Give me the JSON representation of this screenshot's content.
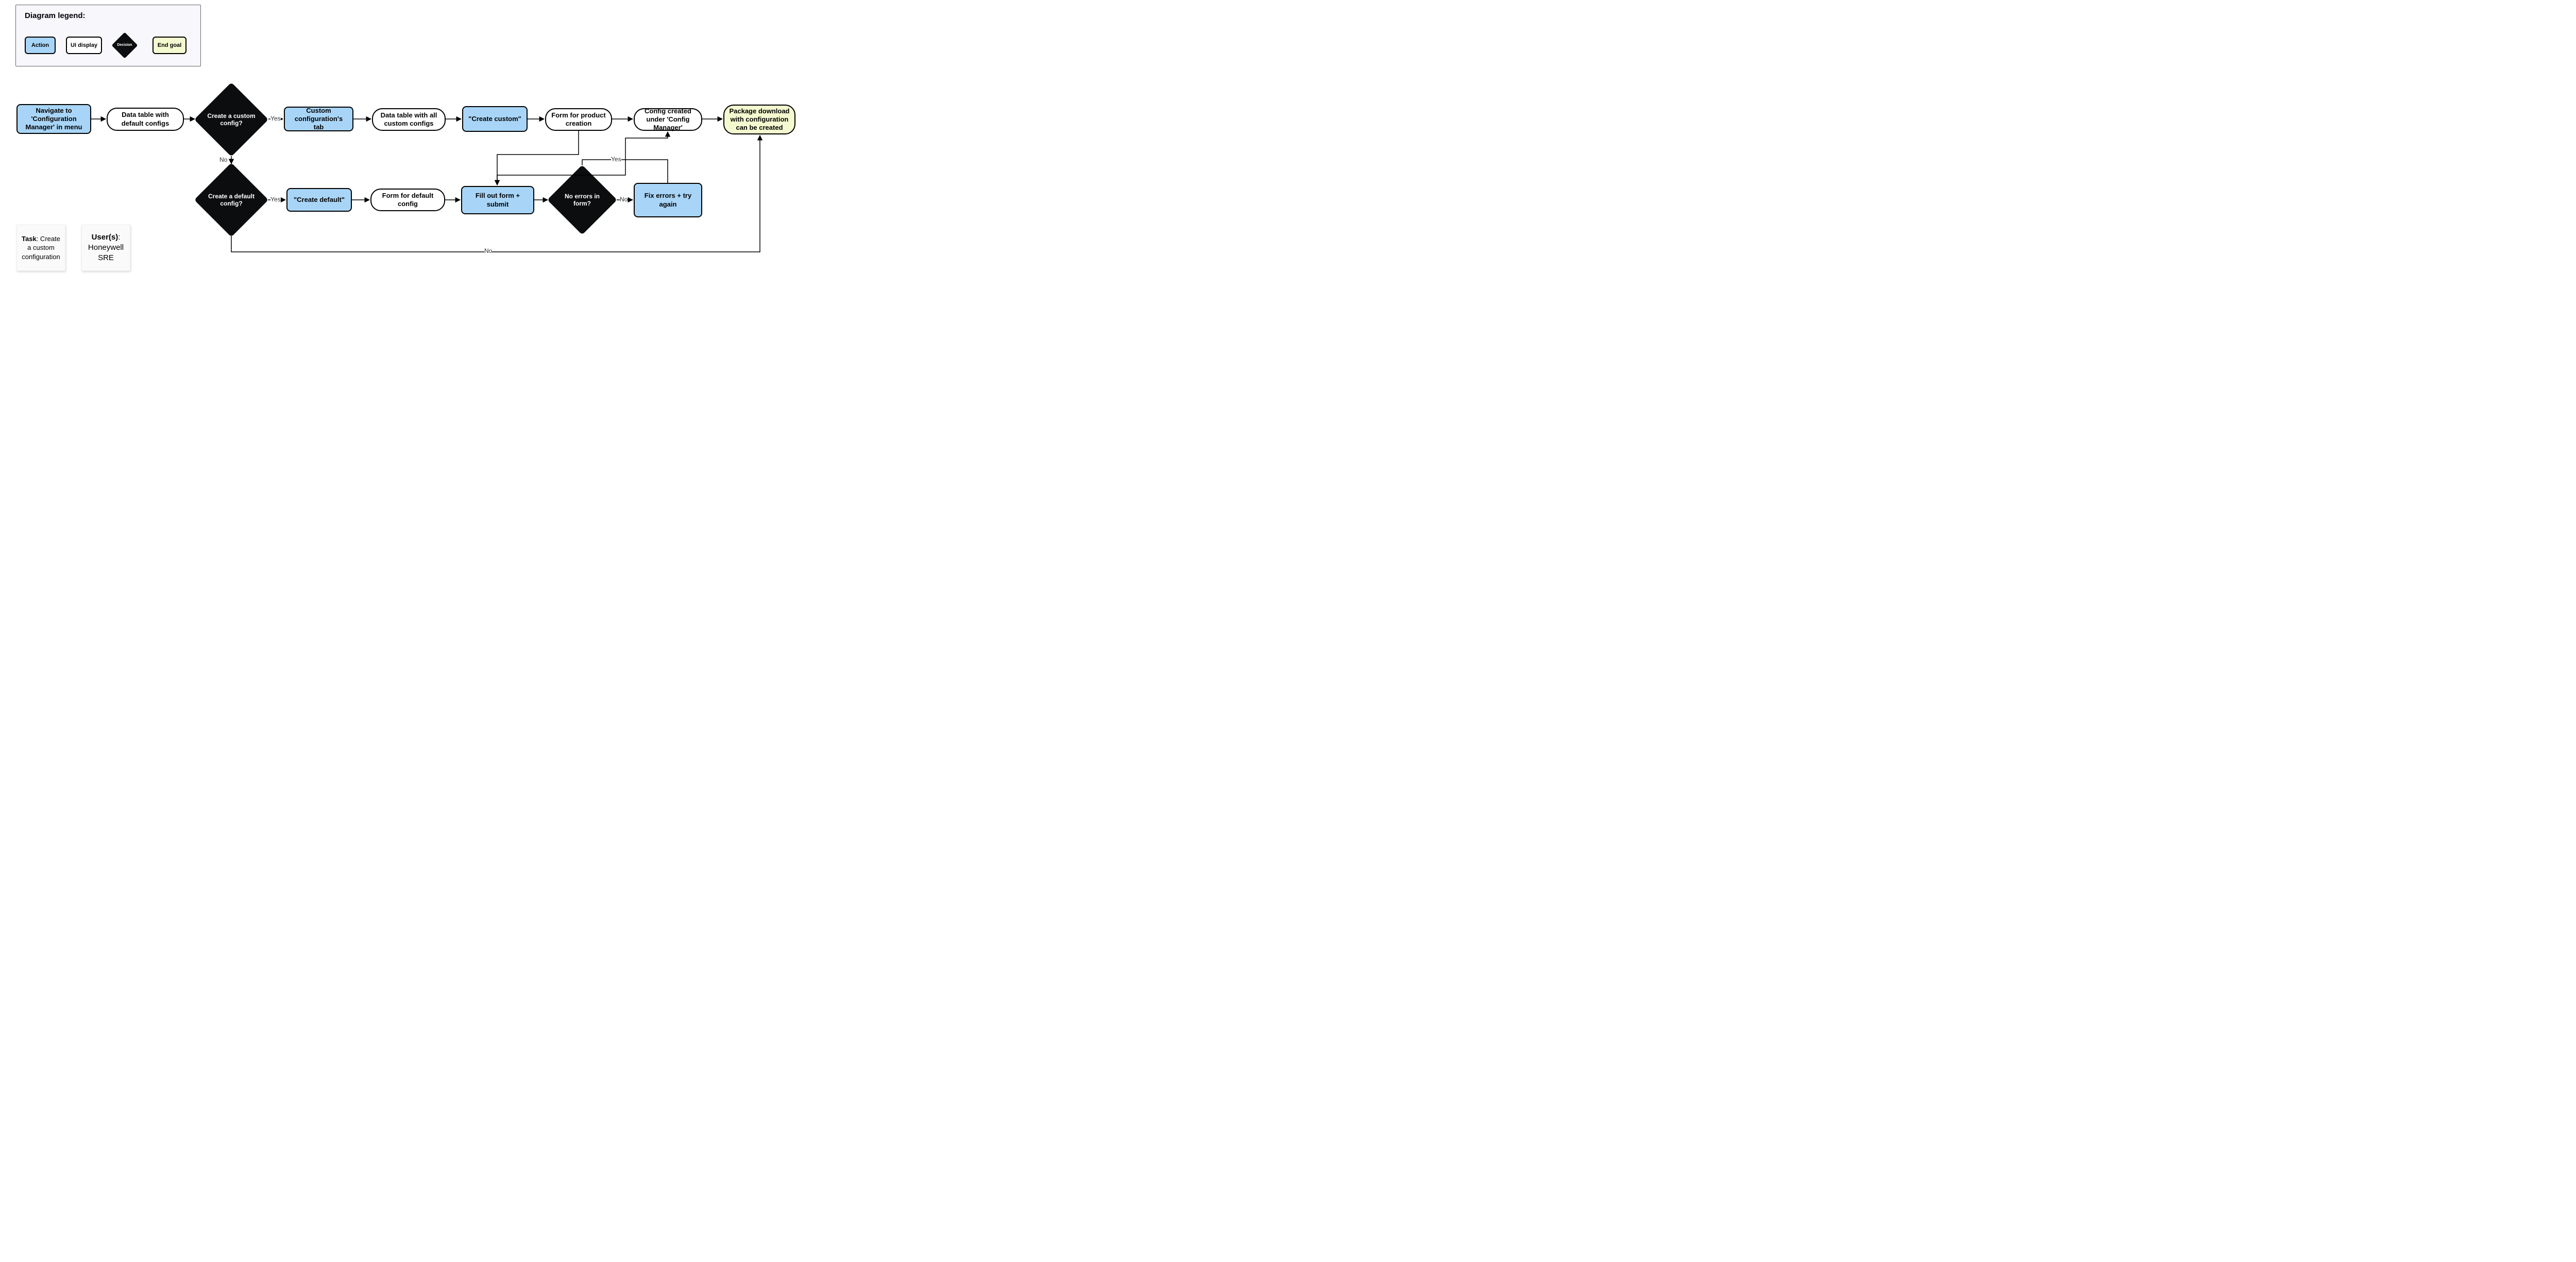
{
  "legend": {
    "title": "Diagram legend:",
    "action": "Action",
    "ui": "UI display",
    "decision": "Decision",
    "goal": "End goal"
  },
  "nodes": {
    "nav": "Navigate to 'Configuration Manager' in menu",
    "defaultTable": "Data table with default configs",
    "customQ": "Create a custom config?",
    "customTab": "Custom configuration's tab",
    "customTable": "Data table with all custom configs",
    "createCustom": "\"Create custom\"",
    "formProduct": "Form for product creation",
    "configCreated": "Config created under 'Config Manager'",
    "packageGoal": "Package download with configuration can be created",
    "defaultQ": "Create a default config?",
    "createDefault": "\"Create default\"",
    "formDefault": "Form for default config",
    "fillForm": "Fill out form + submit",
    "noErrorsQ": "No errors in form?",
    "fixErrors": "Fix errors + try again"
  },
  "edgeLabels": {
    "customYes": "Yes",
    "customNo": "No",
    "defaultYes": "Yes",
    "defaultNo": "No",
    "errorsYes": "Yes",
    "errorsNo": "No"
  },
  "stickies": {
    "task_label": "Task",
    "task_text": ": Create a custom configuration",
    "user_label": "User(s)",
    "user_text": ": Honeywell SRE"
  }
}
